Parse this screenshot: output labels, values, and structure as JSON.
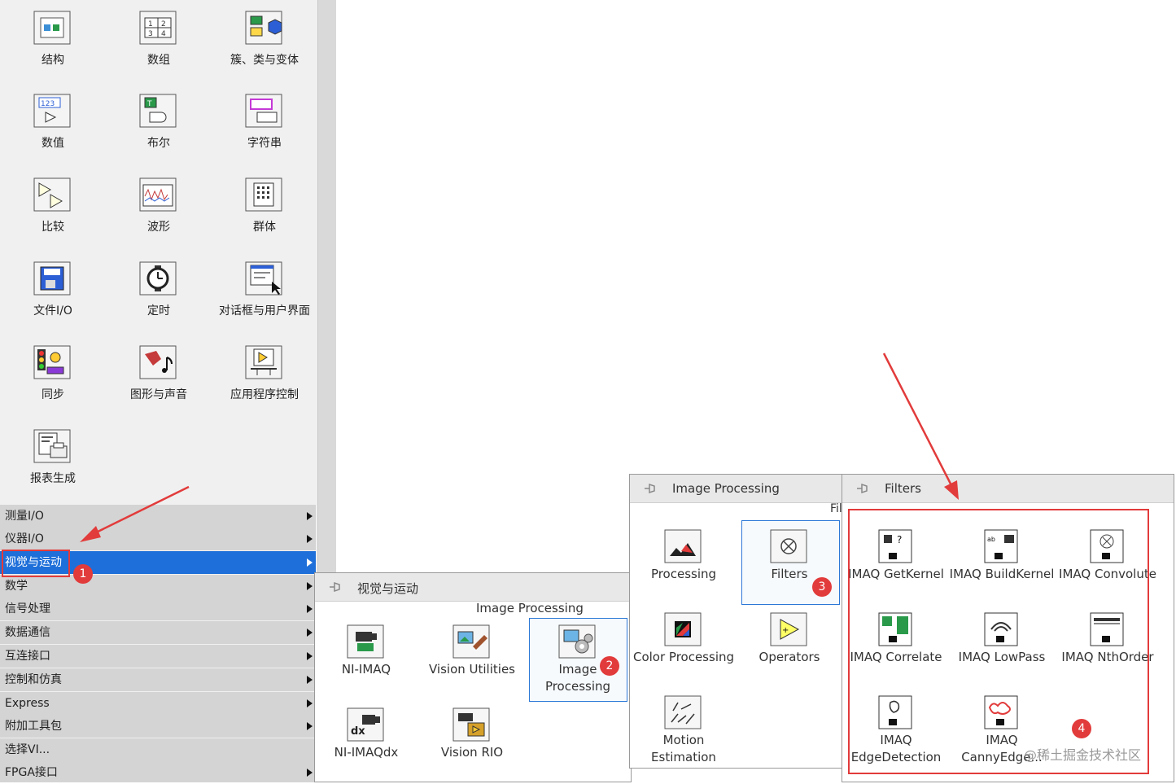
{
  "palette": {
    "items": [
      {
        "label": "结构",
        "icon": "structure-icon"
      },
      {
        "label": "数组",
        "icon": "array-icon"
      },
      {
        "label": "簇、类与变体",
        "icon": "cluster-icon"
      },
      {
        "label": "数值",
        "icon": "numeric-icon"
      },
      {
        "label": "布尔",
        "icon": "boolean-icon"
      },
      {
        "label": "字符串",
        "icon": "string-icon"
      },
      {
        "label": "比较",
        "icon": "comparison-icon"
      },
      {
        "label": "波形",
        "icon": "waveform-icon"
      },
      {
        "label": "群体",
        "icon": "group-icon"
      },
      {
        "label": "文件I/O",
        "icon": "file-io-icon"
      },
      {
        "label": "定时",
        "icon": "timing-icon"
      },
      {
        "label": "对话框与用户界面",
        "icon": "dialog-icon"
      },
      {
        "label": "同步",
        "icon": "sync-icon"
      },
      {
        "label": "图形与声音",
        "icon": "graphics-sound-icon"
      },
      {
        "label": "应用程序控制",
        "icon": "app-control-icon"
      },
      {
        "label": "报表生成",
        "icon": "report-icon"
      }
    ],
    "menu": [
      {
        "label": "测量I/O"
      },
      {
        "label": "仪器I/O"
      },
      {
        "label": "视觉与运动",
        "selected": true
      },
      {
        "label": "数学"
      },
      {
        "label": "信号处理"
      },
      {
        "label": "数据通信"
      },
      {
        "label": "互连接口"
      },
      {
        "label": "控制和仿真"
      },
      {
        "label": "Express"
      },
      {
        "label": "附加工具包"
      },
      {
        "label": "选择VI..."
      },
      {
        "label": "FPGA接口"
      }
    ]
  },
  "vision_panel": {
    "title": "视觉与运动",
    "subheader": "Image Processing",
    "items": [
      {
        "label": "NI-IMAQ"
      },
      {
        "label": "Vision Utilities"
      },
      {
        "label": "Image Processing"
      },
      {
        "label": "NI-IMAQdx"
      },
      {
        "label": "Vision RIO"
      }
    ]
  },
  "ip_panel": {
    "title": "Image Processing",
    "subheader": "Fil",
    "items": [
      {
        "label": "Processing"
      },
      {
        "label": "Filters"
      },
      {
        "label": "Color Processing"
      },
      {
        "label": "Operators"
      },
      {
        "label": "Motion Estimation"
      }
    ]
  },
  "filters_panel": {
    "title": "Filters",
    "items": [
      {
        "label": "IMAQ GetKernel"
      },
      {
        "label": "IMAQ BuildKernel"
      },
      {
        "label": "IMAQ Convolute"
      },
      {
        "label": "IMAQ Correlate"
      },
      {
        "label": "IMAQ LowPass"
      },
      {
        "label": "IMAQ NthOrder"
      },
      {
        "label": "IMAQ EdgeDetection"
      },
      {
        "label": "IMAQ CannyEdge..."
      }
    ]
  },
  "badges": [
    "1",
    "2",
    "3",
    "4"
  ],
  "watermark": "@稀土掘金技术社区",
  "colors": {
    "accent": "#1e6fd9",
    "annotation": "#e23b3b"
  }
}
